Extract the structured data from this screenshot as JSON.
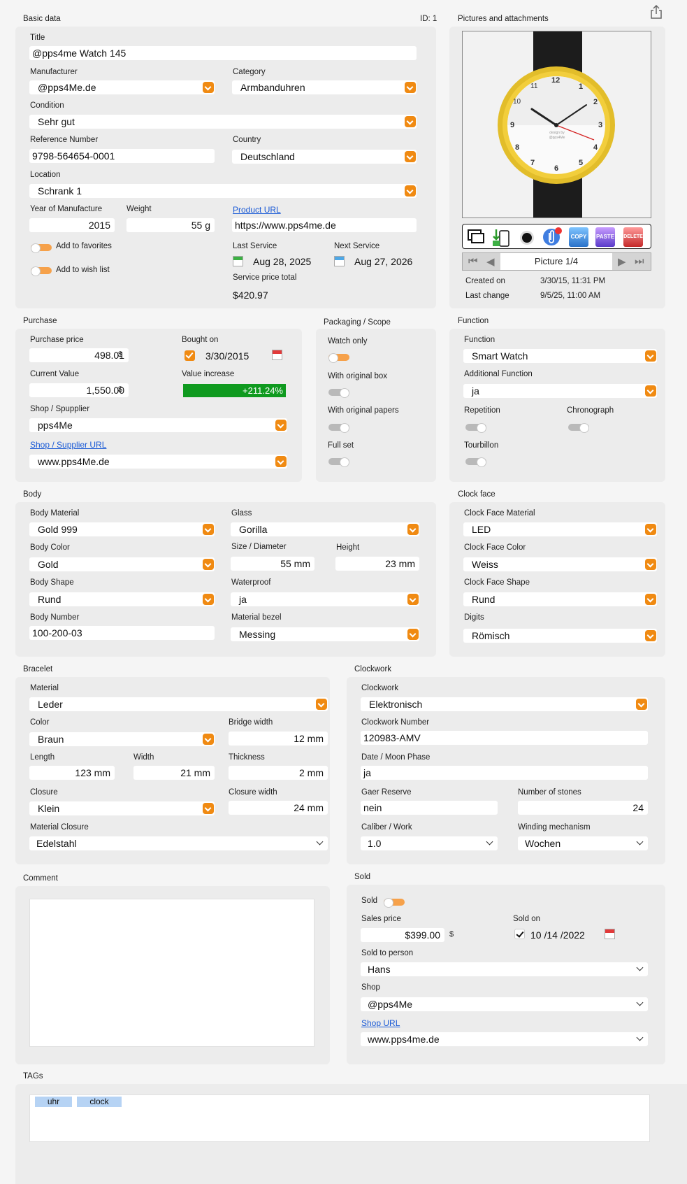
{
  "sections": {
    "basic": "Basic data",
    "id": "ID: 1",
    "pictures": "Pictures and attachments",
    "purchase": "Purchase",
    "packaging": "Packaging / Scope",
    "function": "Function",
    "body": "Body",
    "clockface": "Clock face",
    "bracelet": "Bracelet",
    "clockwork": "Clockwork",
    "comment": "Comment",
    "sold": "Sold",
    "tags": "TAGs"
  },
  "basic": {
    "title_label": "Title",
    "title": "@pps4me Watch 145",
    "manufacturer_label": "Manufacturer",
    "manufacturer": "@pps4Me.de",
    "category_label": "Category",
    "category": "Armbanduhren",
    "condition_label": "Condition",
    "condition": "Sehr gut",
    "refnum_label": "Reference Number",
    "refnum": "9798-564654-0001",
    "country_label": "Country",
    "country": "Deutschland",
    "location_label": "Location",
    "location": "Schrank 1",
    "year_label": "Year of Manufacture",
    "year": "2015",
    "weight_label": "Weight",
    "weight": "55 g",
    "url_label": "Product URL",
    "url": "https://www.pps4me.de",
    "fav_label": "Add to favorites",
    "wish_label": "Add to wish list",
    "last_service_label": "Last Service",
    "last_service": "Aug 28, 2025",
    "next_service_label": "Next Service",
    "next_service": "Aug 27, 2026",
    "service_total_label": "Service price total",
    "service_total": "$420.97"
  },
  "pictures": {
    "design_text": "design by @pps4Me",
    "picture_label": "Picture 1/4",
    "created_label": "Created on",
    "created": "3/30/15, 11:31 PM",
    "changed_label": "Last change",
    "changed": "9/5/25, 11:00 AM",
    "tools": {
      "copy": "COPY",
      "paste": "PASTE",
      "delete": "DELETE"
    },
    "hour_numerals": [
      "12",
      "1",
      "2",
      "3",
      "4",
      "5",
      "6",
      "7",
      "8",
      "9",
      "10",
      "11"
    ]
  },
  "purchase": {
    "price_label": "Purchase price",
    "price": "498.01",
    "currency": "$",
    "bought_label": "Bought on",
    "bought": "3/30/2015",
    "current_label": "Current Value",
    "current": "1,550.00",
    "increase_label": "Value increase",
    "increase": "+211.24%",
    "shop_label": "Shop / Spupplier",
    "shop": "pps4Me",
    "shop_url_label": "Shop / Supplier URL",
    "shop_url": "www.pps4Me.de"
  },
  "packaging": {
    "watch_only": "Watch only",
    "orig_box": "With original box",
    "orig_papers": "With original papers",
    "full_set": "Full set"
  },
  "function": {
    "function_label": "Function",
    "function": "Smart Watch",
    "additional_label": "Additional Function",
    "additional": "ja",
    "repetition": "Repetition",
    "chronograph": "Chronograph",
    "tourbillon": "Tourbillon"
  },
  "body": {
    "material_label": "Body Material",
    "material": "Gold 999",
    "glass_label": "Glass",
    "glass": "Gorilla",
    "color_label": "Body Color",
    "color": "Gold",
    "size_label": "Size / Diameter",
    "size": "55 mm",
    "height_label": "Height",
    "height": "23 mm",
    "shape_label": "Body Shape",
    "shape": "Rund",
    "waterproof_label": "Waterproof",
    "waterproof": "ja",
    "number_label": "Body Number",
    "number": "100-200-03",
    "bezel_label": "Material bezel",
    "bezel": "Messing"
  },
  "clockface": {
    "material_label": "Clock Face Material",
    "material": "LED",
    "color_label": "Clock Face Color",
    "color": "Weiss",
    "shape_label": "Clock Face Shape",
    "shape": "Rund",
    "digits_label": "Digits",
    "digits": "Römisch"
  },
  "bracelet": {
    "material_label": "Material",
    "material": "Leder",
    "color_label": "Color",
    "color": "Braun",
    "bridge_label": "Bridge width",
    "bridge": "12 mm",
    "length_label": "Length",
    "length": "123 mm",
    "width_label": "Width",
    "width": "21 mm",
    "thickness_label": "Thickness",
    "thickness": "2 mm",
    "closure_label": "Closure",
    "closure": "Klein",
    "closure_width_label": "Closure width",
    "closure_width": "24 mm",
    "material_closure_label": "Material Closure",
    "material_closure": "Edelstahl"
  },
  "clockwork": {
    "clockwork_label": "Clockwork",
    "clockwork": "Elektronisch",
    "number_label": "Clockwork Number",
    "number": "120983-AMV",
    "moon_label": "Date / Moon Phase",
    "moon": "ja",
    "reserve_label": "Gaer Reserve",
    "reserve": "nein",
    "stones_label": "Number of stones",
    "stones": "24",
    "caliber_label": "Caliber / Work",
    "caliber": "1.0",
    "winding_label": "Winding mechanism",
    "winding": "Wochen"
  },
  "sold": {
    "sold_label": "Sold",
    "price_label": "Sales price",
    "price": "$399.00",
    "currency": "$",
    "soldon_label": "Sold on",
    "soldon": "10 /14 /2022",
    "person_label": "Sold to person",
    "person": "Hans",
    "shop_label": "Shop",
    "shop": "@pps4Me",
    "url_label": "Shop URL",
    "url": "www.pps4me.de"
  },
  "tags": [
    "uhr",
    "clock"
  ],
  "colors": {
    "accent": "#f08a12",
    "increase_bg": "#0f9a1f"
  }
}
